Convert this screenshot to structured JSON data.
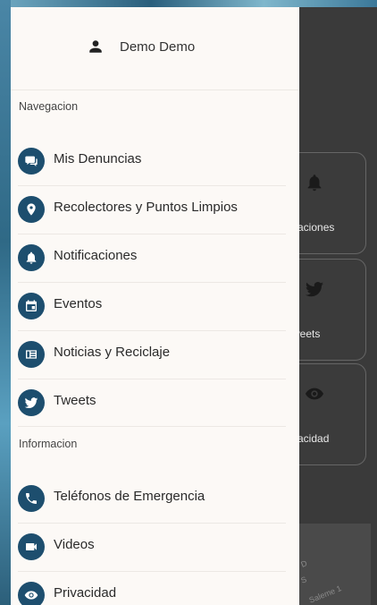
{
  "user": {
    "name": "Demo Demo",
    "icon": "person-icon"
  },
  "sections": {
    "navegacion": "Navegacion",
    "informacion": "Informacion"
  },
  "nav_items": [
    {
      "label": "Mis Denuncias",
      "icon": "chat-icon"
    },
    {
      "label": "Recolectores y Puntos Limpios",
      "icon": "location-pin-icon"
    },
    {
      "label": "Notificaciones",
      "icon": "bell-icon"
    },
    {
      "label": "Eventos",
      "icon": "calendar-icon"
    },
    {
      "label": "Noticias y Reciclaje",
      "icon": "newspaper-icon"
    },
    {
      "label": "Tweets",
      "icon": "twitter-icon"
    }
  ],
  "info_items": [
    {
      "label": "Teléfonos de Emergencia",
      "icon": "phone-icon"
    },
    {
      "label": "Videos",
      "icon": "video-camera-icon"
    },
    {
      "label": "Privacidad",
      "icon": "eye-icon"
    }
  ],
  "background_cards": [
    {
      "label": "caciones",
      "icon": "bell-icon"
    },
    {
      "label": "weets",
      "icon": "twitter-icon"
    },
    {
      "label": "vacidad",
      "icon": "eye-icon"
    }
  ],
  "background_map": {
    "labels": [
      "D",
      "S",
      "Saleme 1"
    ]
  },
  "colors": {
    "accent": "#1d4e6e",
    "drawer_bg": "#fcf9f6",
    "overlay": "#3a3a3a"
  }
}
